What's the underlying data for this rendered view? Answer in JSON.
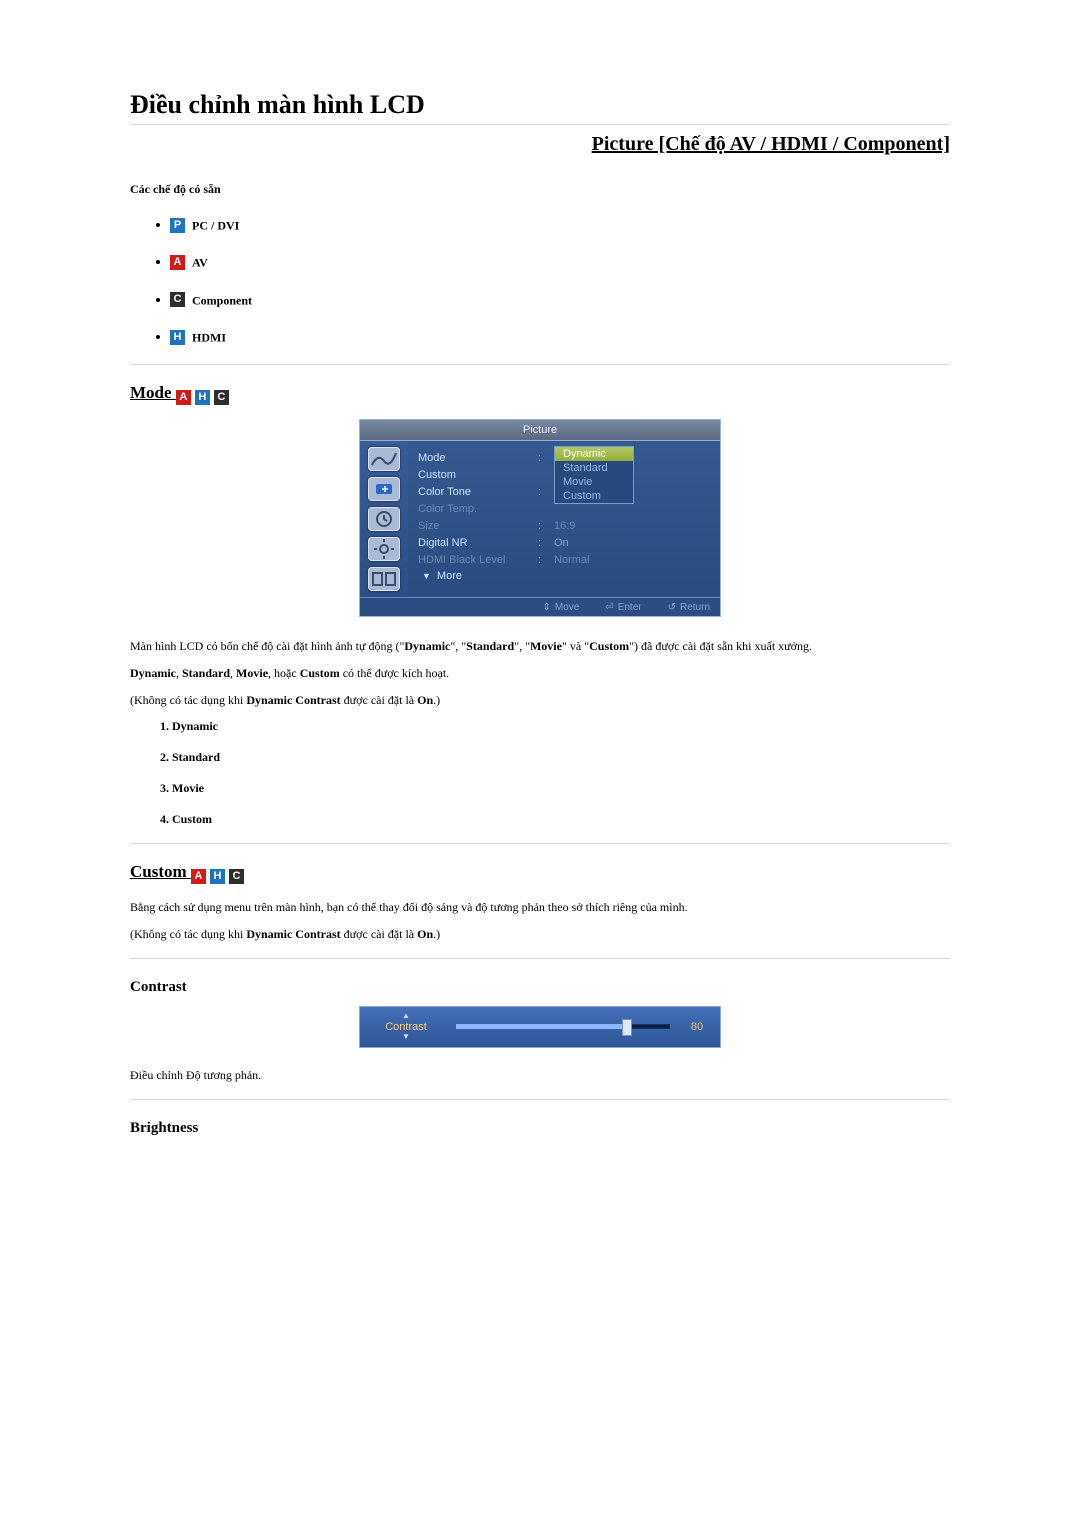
{
  "title": "Điều chỉnh màn hình LCD",
  "subtitle": "Picture [Chế độ AV / HDMI / Component]",
  "modes_label": "Các chế độ có sẵn",
  "mode_list": {
    "p": {
      "badge": "P",
      "name": "PC / DVI"
    },
    "a": {
      "badge": "A",
      "name": "AV"
    },
    "c": {
      "badge": "C",
      "name": "Component"
    },
    "h": {
      "badge": "H",
      "name": "HDMI"
    }
  },
  "sections": {
    "mode": {
      "heading": "Mode",
      "osd_title": "Picture",
      "rows": {
        "r0": {
          "label": "Mode",
          "val": ""
        },
        "r1": {
          "label": "Custom",
          "val": ""
        },
        "r2": {
          "label": "Color Tone",
          "val": ""
        },
        "r3": {
          "label": "Color Temp.",
          "val": ""
        },
        "r4": {
          "label": "Size",
          "val": "16:9"
        },
        "r5": {
          "label": "Digital NR",
          "val": "On"
        },
        "r6": {
          "label": "HDMI Black Level",
          "val": "Normal"
        }
      },
      "more": "More",
      "dropdown": {
        "o0": "Dynamic",
        "o1": "Standard",
        "o2": "Movie",
        "o3": "Custom"
      },
      "footer": {
        "move": "Move",
        "enter": "Enter",
        "return": "Return"
      },
      "para1_a": "Màn hình LCD có bốn chế độ cài đặt hình ảnh tự động (\"",
      "para1_b": "Dynamic",
      "para1_c": "\", \"",
      "para1_d": "Standard",
      "para1_e": "\", \"",
      "para1_f": "Movie",
      "para1_g": "\" và \"",
      "para1_h": "Custom",
      "para1_i": "\") đã được cài đặt sẵn khi xuất xưởng.",
      "para2_a": "Dynamic",
      "para2_b": ", ",
      "para2_c": "Standard",
      "para2_d": ", ",
      "para2_e": "Movie",
      "para2_f": ", hoặc ",
      "para2_g": "Custom",
      "para2_h": " có thể được kích hoạt.",
      "para3_a": "(Không có tác dụng khi ",
      "para3_b": "Dynamic Contrast",
      "para3_c": " được cài đặt là ",
      "para3_d": "On",
      "para3_e": ".)",
      "list": {
        "l1": "Dynamic",
        "l2": "Standard",
        "l3": "Movie",
        "l4": "Custom"
      }
    },
    "custom": {
      "heading": "Custom",
      "para1": "Bằng cách sử dụng menu trên màn hình, bạn có thể thay đổi độ sáng và độ tương phản theo sở thích riêng của mình.",
      "para2_a": "(Không có tác dụng khi ",
      "para2_b": "Dynamic Contrast",
      "para2_c": " được cài đặt là ",
      "para2_d": "On",
      "para2_e": ".)"
    },
    "contrast": {
      "heading": "Contrast",
      "slider_label": "Contrast",
      "slider_value": "80",
      "desc": "Điều chỉnh Độ tương phản."
    },
    "brightness": {
      "heading": "Brightness"
    }
  }
}
